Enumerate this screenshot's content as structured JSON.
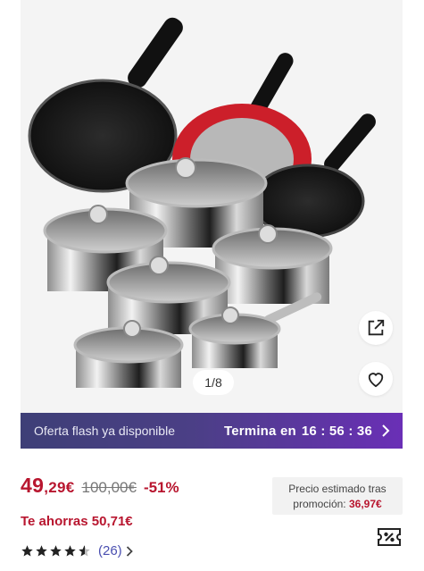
{
  "gallery": {
    "counter": "1/8",
    "share_icon": "share-external-icon",
    "favorite_icon": "heart-icon"
  },
  "flash": {
    "left_label": "Oferta flash ya disponible",
    "ends_label": "Termina en",
    "timer": "16 : 56 : 36"
  },
  "price": {
    "main_int": "49",
    "main_dec": ",29€",
    "old": "100,00€",
    "discount": "-51%"
  },
  "promo": {
    "label": "Precio estimado tras promoción:",
    "value": "36,97€"
  },
  "savings": "Te ahorras 50,71€",
  "rating": {
    "stars": 4.5,
    "count": "(26)"
  },
  "colors": {
    "price_red": "#b8162f",
    "flash_start": "#3e3f77",
    "flash_end": "#6a2fb6",
    "link_blue": "#4a4fb0"
  }
}
